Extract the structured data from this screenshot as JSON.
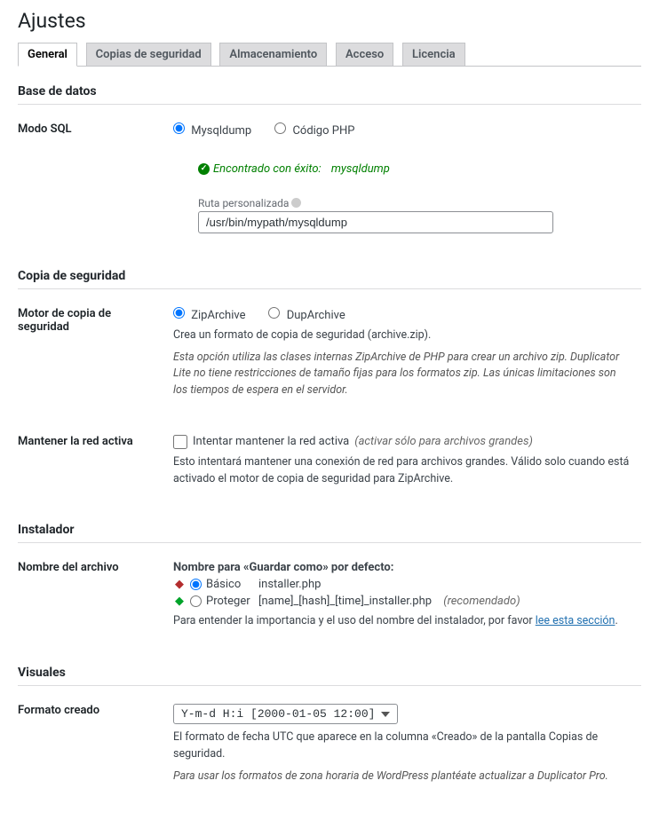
{
  "page_title": "Ajustes",
  "tabs": [
    {
      "label": "General"
    },
    {
      "label": "Copias de seguridad"
    },
    {
      "label": "Almacenamiento"
    },
    {
      "label": "Acceso"
    },
    {
      "label": "Licencia"
    }
  ],
  "sections": {
    "database": {
      "heading": "Base de datos",
      "sql_mode_label": "Modo SQL",
      "radio_mysqldump": "Mysqldump",
      "radio_php": "Código PHP",
      "success_prefix": "Encontrado con éxito:",
      "success_value": "mysqldump",
      "custom_path_label": "Ruta personalizada",
      "custom_path_value": "/usr/bin/mypath/mysqldump"
    },
    "backup": {
      "heading": "Copia de seguridad",
      "engine_label": "Motor de copia de seguridad",
      "radio_zip": "ZipArchive",
      "radio_dup": "DupArchive",
      "engine_desc1": "Crea un formato de copia de seguridad (archive.zip).",
      "engine_desc2": "Esta opción utiliza las clases internas ZipArchive de PHP para crear un archivo zip.  Duplicator Lite no tiene restricciones de tamaño fijas para los formatos zip. Las únicas limitaciones son los tiempos de espera en el servidor.",
      "keepalive_label": "Mantener la red activa",
      "keepalive_checkbox": "Intentar mantener la red activa",
      "keepalive_paren": "(activar sólo para archivos grandes)",
      "keepalive_desc": "Esto intentará mantener una conexión de red para archivos grandes.  Válido solo cuando está activado el motor de copia de seguridad para ZipArchive."
    },
    "installer": {
      "heading": "Instalador",
      "filename_label": "Nombre del archivo",
      "saveas_label": "Nombre para «Guardar como» por defecto:",
      "basic_label": "Básico",
      "basic_value": "installer.php",
      "protect_label": "Proteger",
      "protect_value": "[name]_[hash]_[time]_installer.php",
      "protect_rec": "(recomendado)",
      "footnote_prefix": "Para entender la importancia y el uso del nombre del instalador, por favor ",
      "footnote_link": "lee esta sección",
      "footnote_suffix": "."
    },
    "visuals": {
      "heading": "Visuales",
      "format_label": "Formato creado",
      "format_selected": "Y-m-d H:i  [2000-01-05 12:00]",
      "desc1": "El formato de fecha UTC que aparece en la columna «Creado» de la pantalla Copias de seguridad.",
      "desc2": "Para usar los formatos de zona horaria de WordPress plantéate actualizar a Duplicator Pro."
    }
  }
}
